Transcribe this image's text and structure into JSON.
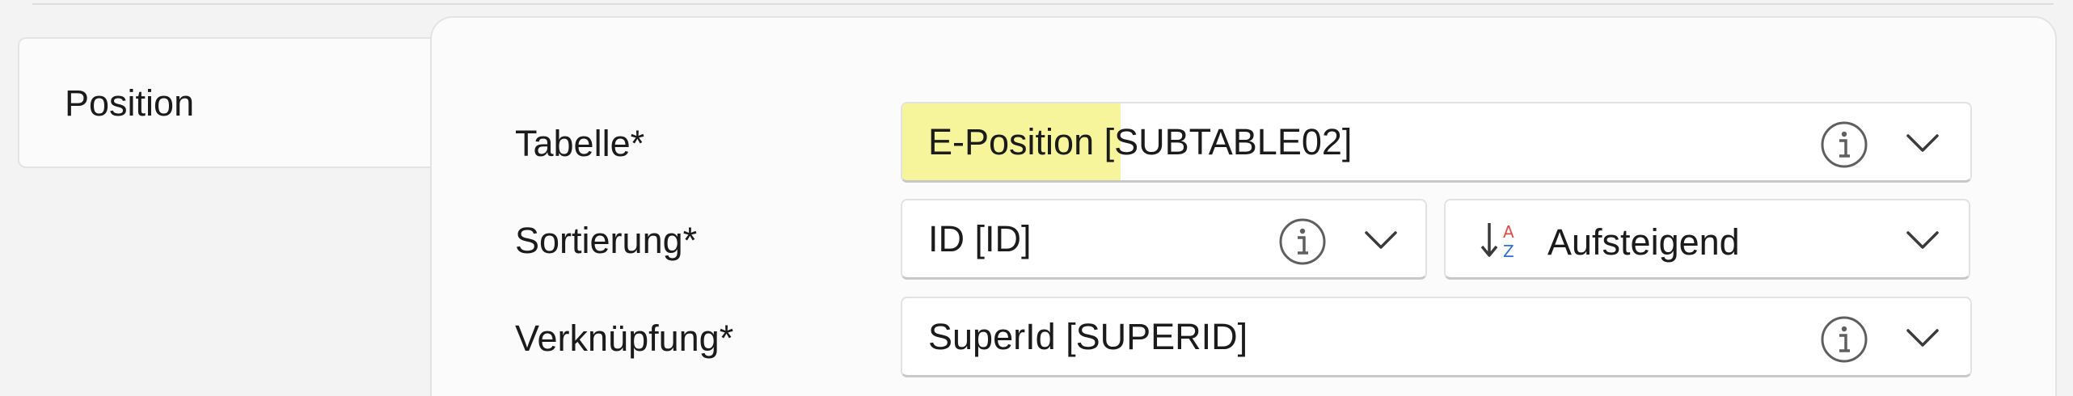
{
  "tab": {
    "label": "Position"
  },
  "fields": {
    "table": {
      "label": "Tabelle*",
      "highlight": "E-Position",
      "value_rest": " [SUBTABLE02]"
    },
    "sort": {
      "label": "Sortierung*",
      "value": "ID [ID]",
      "direction": "Aufsteigend"
    },
    "link": {
      "label": "Verknüpfung*",
      "value": "SuperId [SUPERID]"
    }
  },
  "icons": {
    "info": "info-icon",
    "chevron": "chevron-down-icon",
    "sort_ascending": "sort-ascending-icon"
  },
  "colors": {
    "highlight": "#f7f59c",
    "sort_icon_red": "#e04a4a",
    "sort_icon_blue": "#2f6fd6"
  }
}
